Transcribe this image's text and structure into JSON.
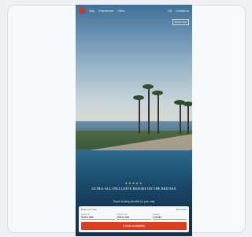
{
  "header": {
    "nav_items": [
      "Stay",
      "Experiences",
      "Offers"
    ],
    "right_items": [
      "EN",
      "Contact us"
    ],
    "book_label": "Book now"
  },
  "hero": {
    "stars": "★★★★★",
    "headline": "ULTRA-ALL-INCLUSIVE RESORT ON THE RED SEA",
    "subline": "Direct booking benefits for your stay"
  },
  "booking_form": {
    "title": "Book your stay",
    "link": "Best price",
    "fields": [
      {
        "label": "Check-in",
        "value": "Select date"
      },
      {
        "label": "Check-out",
        "value": "Select date"
      },
      {
        "label": "Guests",
        "value": "2 Adults"
      }
    ],
    "cta_label": "Check availability"
  },
  "colors": {
    "accent": "#d9401f",
    "logo": "#c8392b"
  },
  "icons": [
    "brand-logo-icon"
  ]
}
